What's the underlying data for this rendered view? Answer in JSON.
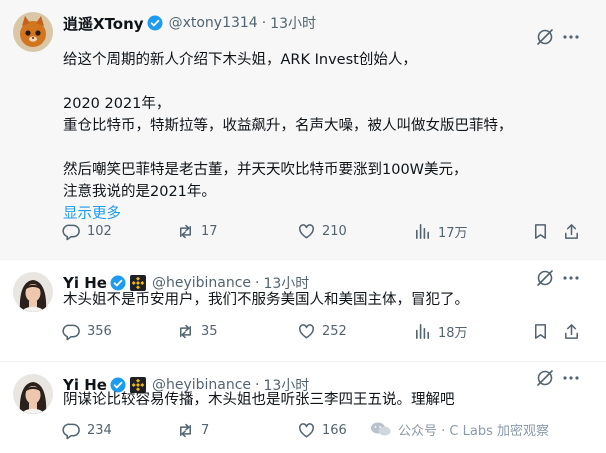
{
  "tweets": [
    {
      "author": "逍遥XTony",
      "handle": "@xtony1314",
      "time": "13小时",
      "lines": [
        "给这个周期的新人介绍下木头姐，ARK Invest创始人，",
        "",
        "2020 2021年，",
        "重仓比特币，特斯拉等，收益飙升，名声大噪，被人叫做女版巴菲特，",
        "",
        "然后嘲笑巴菲特是老古董，并天天吹比特币要涨到100W美元，",
        "注意我说的是2021年。"
      ],
      "show_more": "显示更多",
      "replies": "102",
      "retweets": "17",
      "likes": "210",
      "views": "17万"
    },
    {
      "author": "Yi He",
      "handle": "@heyibinance",
      "time": "13小时",
      "lines": [
        "木头姐不是币安用户，我们不服务美国人和美国主体，冒犯了。"
      ],
      "replies": "356",
      "retweets": "35",
      "likes": "252",
      "views": "18万"
    },
    {
      "author": "Yi He",
      "handle": "@heyibinance",
      "time": "13小时",
      "lines": [
        "阴谋论比较容易传播，木头姐也是听张三李四王五说。理解吧"
      ],
      "replies": "234",
      "retweets": "7",
      "likes": "166"
    }
  ],
  "separator": "·",
  "watermark": "公众号 · C Labs 加密观察",
  "colors": {
    "verified": "#1d9bf0",
    "binance": "#f0b90b",
    "muted": "#536471",
    "link": "#1d9bf0"
  },
  "icons": [
    "grok-icon",
    "more-icon",
    "reply-icon",
    "retweet-icon",
    "like-icon",
    "views-icon",
    "bookmark-icon",
    "share-icon",
    "verified-badge-icon",
    "binance-badge-icon"
  ]
}
